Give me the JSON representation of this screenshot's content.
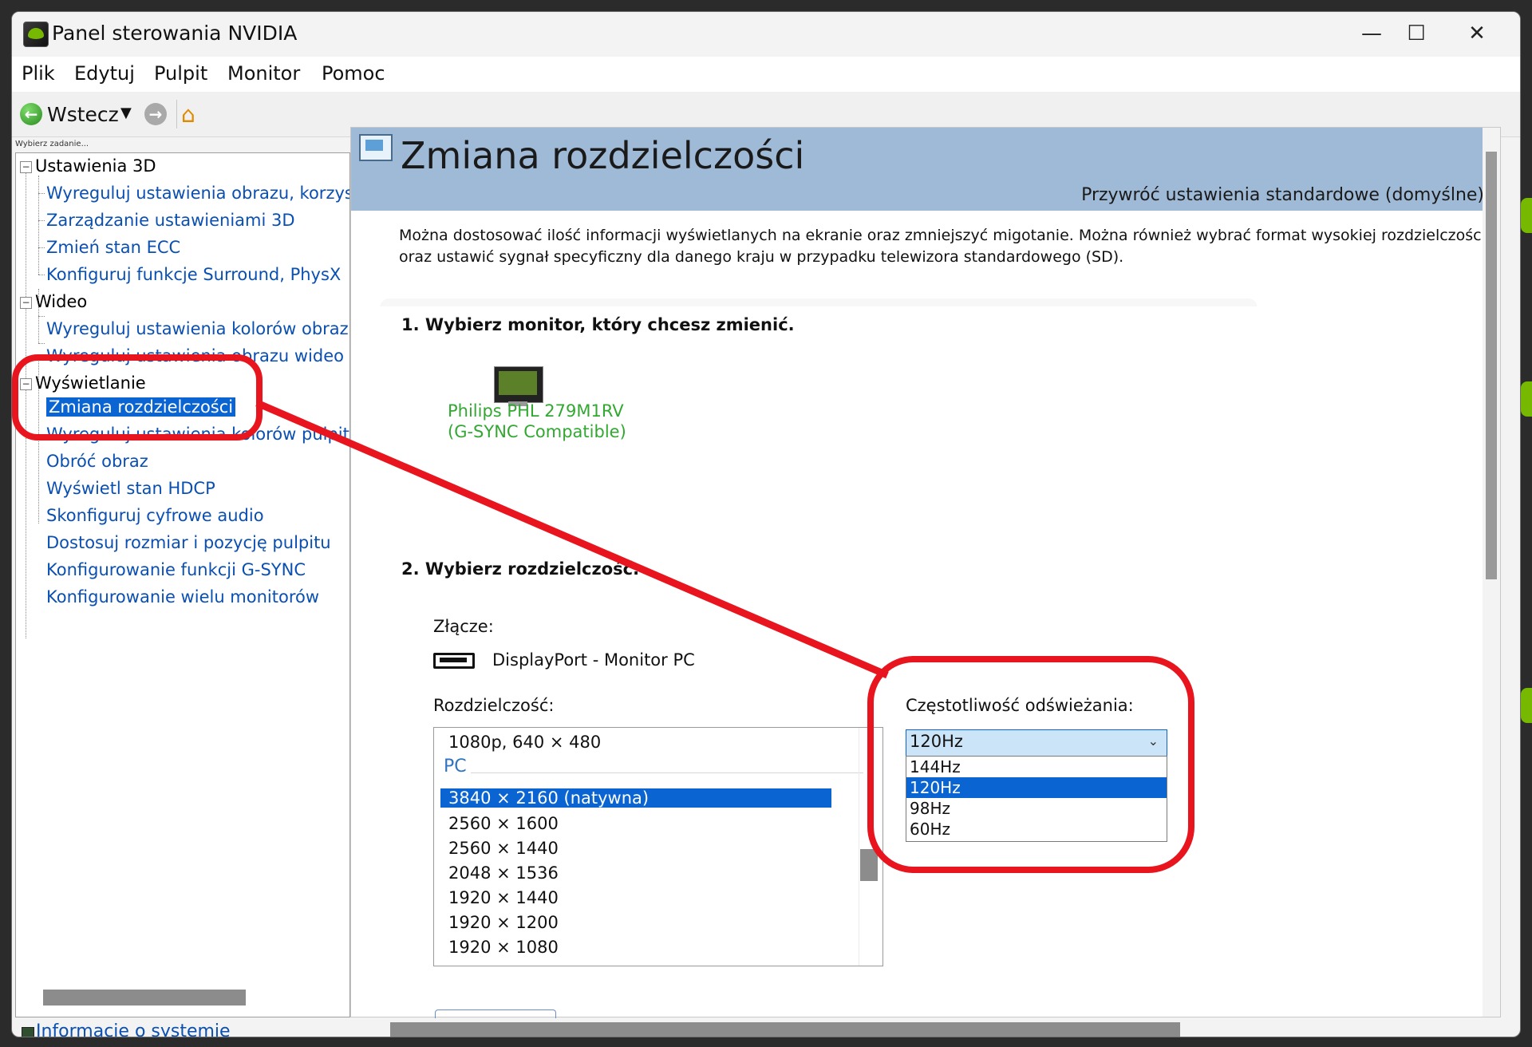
{
  "window": {
    "title": "Panel sterowania NVIDIA"
  },
  "title_bar": {
    "minimize_glyph": "—",
    "maximize_glyph": "☐",
    "close_glyph": "✕"
  },
  "menu": [
    "Plik",
    "Edytuj",
    "Pulpit",
    "Monitor",
    "Pomoc"
  ],
  "toolbar": {
    "back_label": "Wstecz",
    "back_glyph": "←",
    "dropdown_glyph": "▼",
    "forward_glyph": "→",
    "home_glyph": "⌂"
  },
  "nav": {
    "task_label": "Wybierz zadanie...",
    "toggle_glyph": "−",
    "categories": [
      {
        "label": "Ustawienia 3D",
        "items": [
          "Wyreguluj ustawienia obrazu, korzysta",
          "Zarządzanie ustawieniami 3D",
          "Zmień stan ECC",
          "Konfiguruj funkcje Surround, PhysX"
        ]
      },
      {
        "label": "Wideo",
        "items": [
          "Wyreguluj ustawienia kolorów obrazu w",
          "Wyreguluj ustawienia obrazu wideo"
        ]
      },
      {
        "label": "Wyświetlanie",
        "items": [
          "Zmiana rozdzielczości",
          "Wyreguluj ustawienia kolorów pulpitu",
          "Obróć obraz",
          "Wyświetl stan HDCP",
          "Skonfiguruj cyfrowe audio",
          "Dostosuj rozmiar i pozycję pulpitu",
          "Konfigurowanie funkcji G-SYNC",
          "Konfigurowanie wielu monitorów"
        ]
      }
    ],
    "selected_item": "Zmiana rozdzielczości",
    "system_info_link": "Informacje o systemie"
  },
  "content": {
    "title": "Zmiana rozdzielczości",
    "restore_defaults": "Przywróć ustawienia standardowe (domyślne)",
    "description_line1": "Można dostosować ilość informacji wyświetlanych na ekranie oraz zmniejszyć migotanie. Można również wybrać format wysokiej rozdzielczośc",
    "description_line2": "oraz ustawić sygnał specyficzny dla danego kraju w przypadku telewizora standardowego (SD).",
    "step1": "1. Wybierz monitor, który chcesz zmienić.",
    "monitor_name_line1": "Philips PHL 279M1RV",
    "monitor_name_line2": "(G-SYNC Compatible)",
    "step2": "2. Wybierz rozdzielczość.",
    "connector_label": "Złącze:",
    "connector_value": "DisplayPort - Monitor PC",
    "resolution_label": "Rozdzielczość:",
    "resolutions": {
      "tv_item": "1080p, 640 × 480",
      "group_pc": "PC",
      "items": [
        "3840 × 2160 (natywna)",
        "2560 × 1600",
        "2560 × 1440",
        "2048 × 1536",
        "1920 × 1440",
        "1920 × 1200",
        "1920 × 1080"
      ],
      "selected": "3840 × 2160 (natywna)"
    },
    "refresh_label": "Częstotliwość odświeżania:",
    "refresh_selected": "120Hz",
    "refresh_chevron": "⌄",
    "refresh_options": [
      "144Hz",
      "120Hz",
      "98Hz",
      "60Hz"
    ]
  },
  "annotation": {
    "color": "#e8141e"
  }
}
